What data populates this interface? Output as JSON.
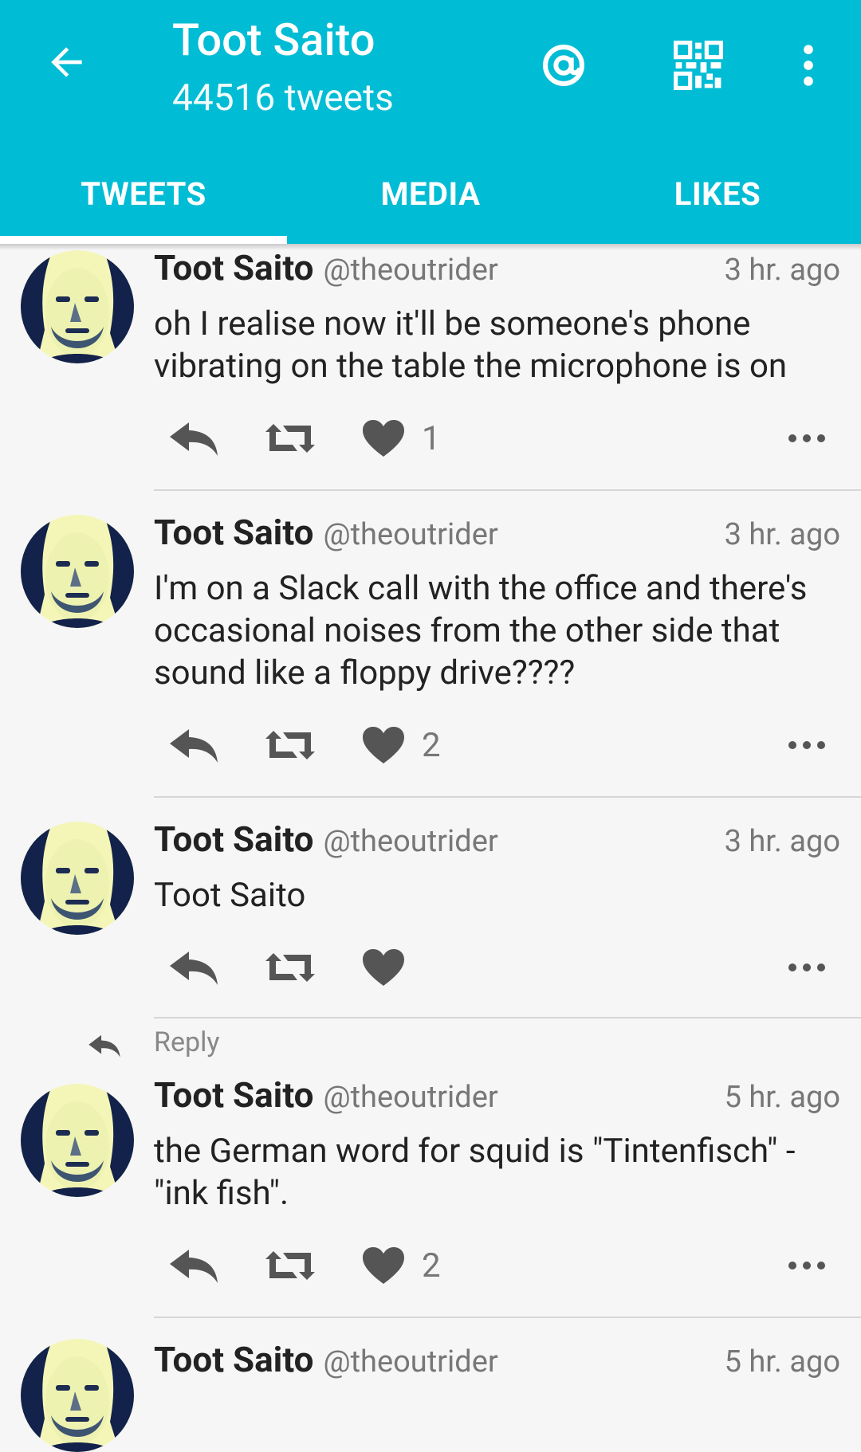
{
  "header": {
    "title": "Toot Saito",
    "subtitle": "44516 tweets",
    "tabs": [
      {
        "label": "TWEETS",
        "active": true
      },
      {
        "label": "MEDIA",
        "active": false
      },
      {
        "label": "LIKES",
        "active": false
      }
    ],
    "background_color": "#00bcd4",
    "icons": [
      "arrow-back-icon",
      "at-icon",
      "qr-code-icon",
      "more-vert-icon"
    ]
  },
  "tweets": [
    {
      "name": "Toot Saito",
      "handle": "@theoutrider",
      "time": "3 hr. ago",
      "text": "oh I realise now it'll be someone's phone vibrating on the table the microphone is on",
      "likes": "1"
    },
    {
      "name": "Toot Saito",
      "handle": "@theoutrider",
      "time": "3 hr. ago",
      "text": "I'm on a Slack call with the office and there's occasional noises from the other side that sound like a floppy drive????",
      "likes": "2"
    },
    {
      "name": "Toot Saito",
      "handle": "@theoutrider",
      "time": "3 hr. ago",
      "text": "Toot Saito",
      "likes": ""
    },
    {
      "reply_label": "Reply",
      "name": "Toot Saito",
      "handle": "@theoutrider",
      "time": "5 hr. ago",
      "text": "the German word for squid is \"Tintenfisch\" - \"ink fish\".",
      "likes": "2"
    },
    {
      "name": "Toot Saito",
      "handle": "@theoutrider",
      "time": "5 hr. ago"
    }
  ]
}
